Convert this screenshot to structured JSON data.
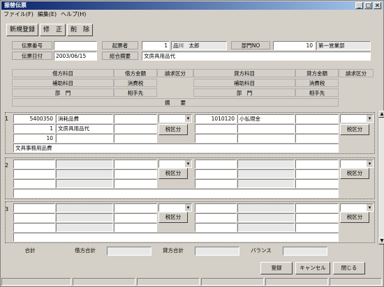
{
  "window": {
    "title": "振替伝票",
    "btn_min": "_",
    "btn_max": "□",
    "btn_close": "×"
  },
  "menu": [
    "ファイル(F)",
    "編集(E)",
    "ヘルプ(H)"
  ],
  "toolbar": {
    "new": "新規登録",
    "edit": "修　正",
    "del": "削　除"
  },
  "header": {
    "slip_no_label": "伝票番号",
    "slip_no": "",
    "drafter_label": "起票者",
    "drafter_id": "1",
    "drafter_name": "品川　太郎",
    "dept_label": "部門NO",
    "dept_no": "10",
    "dept_name": "第一営業部",
    "date_label": "伝票日付",
    "date": "2003/06/15",
    "summary_label": "総合摘要",
    "summary": "文房具用品代"
  },
  "columns": {
    "debit_account": "借方科目",
    "debit_amount": "借方金額",
    "billing": "請求区分",
    "credit_account": "貸方科目",
    "credit_amount": "貸方金額",
    "billing2": "請求区分",
    "debit_sub": "補助科目",
    "tax1": "消費税",
    "credit_sub": "補助科目",
    "tax2": "消費税",
    "dept1": "部　門",
    "partner1": "相手先",
    "dept2": "部　門",
    "partner2": "相手先",
    "memo": "摘　　要"
  },
  "rows": [
    {
      "no": "1",
      "debit_code": "5400350",
      "debit_name": "消耗品費",
      "debit_sub_code": "1",
      "debit_sub_name": "文房具用品代",
      "debit_dept": "10",
      "credit_code": "1010120",
      "credit_name": "小払現金",
      "memo": "文具事務用品費",
      "tax_btn": "税区分"
    },
    {
      "no": "2",
      "debit_code": "",
      "debit_name": "",
      "debit_sub_code": "",
      "debit_sub_name": "",
      "debit_dept": "",
      "credit_code": "",
      "credit_name": "",
      "memo": "",
      "tax_btn": "税区分"
    },
    {
      "no": "3",
      "debit_code": "",
      "debit_name": "",
      "debit_sub_code": "",
      "debit_sub_name": "",
      "debit_dept": "",
      "credit_code": "",
      "credit_name": "",
      "memo": "",
      "tax_btn": "税区分"
    }
  ],
  "footer": {
    "total": "合計",
    "debit_total": "借方合計",
    "credit_total": "貸方合計",
    "balance": "バランス",
    "register": "登録",
    "cancel": "キャンセル",
    "close": "閉じる"
  }
}
